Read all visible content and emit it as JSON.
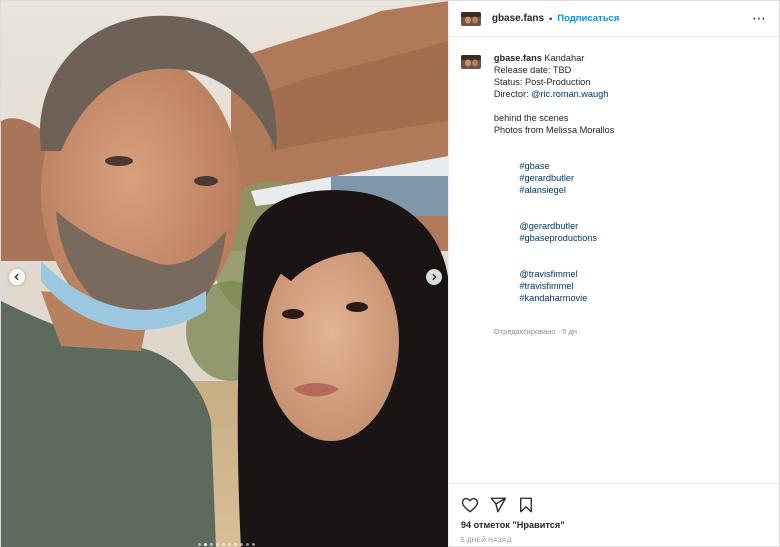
{
  "account": {
    "username": "gbase.fans",
    "separator": "•",
    "follow_label": "Подписаться",
    "more_icon": "more-horizontal-icon"
  },
  "caption": {
    "username": "gbase.fans",
    "first_line": "Kandahar",
    "lines": [
      "Release date: TBD",
      "Status: Post-Production"
    ],
    "director_label": "Director: ",
    "director_link": "@ric.roman.waugh",
    "lines2": [
      "behind the scenes",
      "Photos from Melissa Morallos"
    ],
    "tags_line1": [
      "#gbase",
      "#gerardbutler",
      "#alansiegel"
    ],
    "tags_line2": [
      "@gerardbutler",
      "#gbaseproductions"
    ],
    "tags_line3": [
      "@travisfimmel",
      "#travisfimmel",
      "#kandaharmovie"
    ],
    "edited": "Отредактировано · 5 дн."
  },
  "actions": {
    "like_icon": "heart-icon",
    "share_icon": "send-icon",
    "save_icon": "bookmark-icon",
    "likes_text": "94 отметок \"Нравится\"",
    "posted_ago": "5 ДНЕЙ НАЗАД"
  },
  "media": {
    "prev_icon": "chevron-left-icon",
    "next_icon": "chevron-right-icon",
    "dot_count": 10,
    "active_dot": 1
  },
  "colors": {
    "accent": "#0095f6",
    "link": "#00376b",
    "muted": "#8e8e8e"
  }
}
